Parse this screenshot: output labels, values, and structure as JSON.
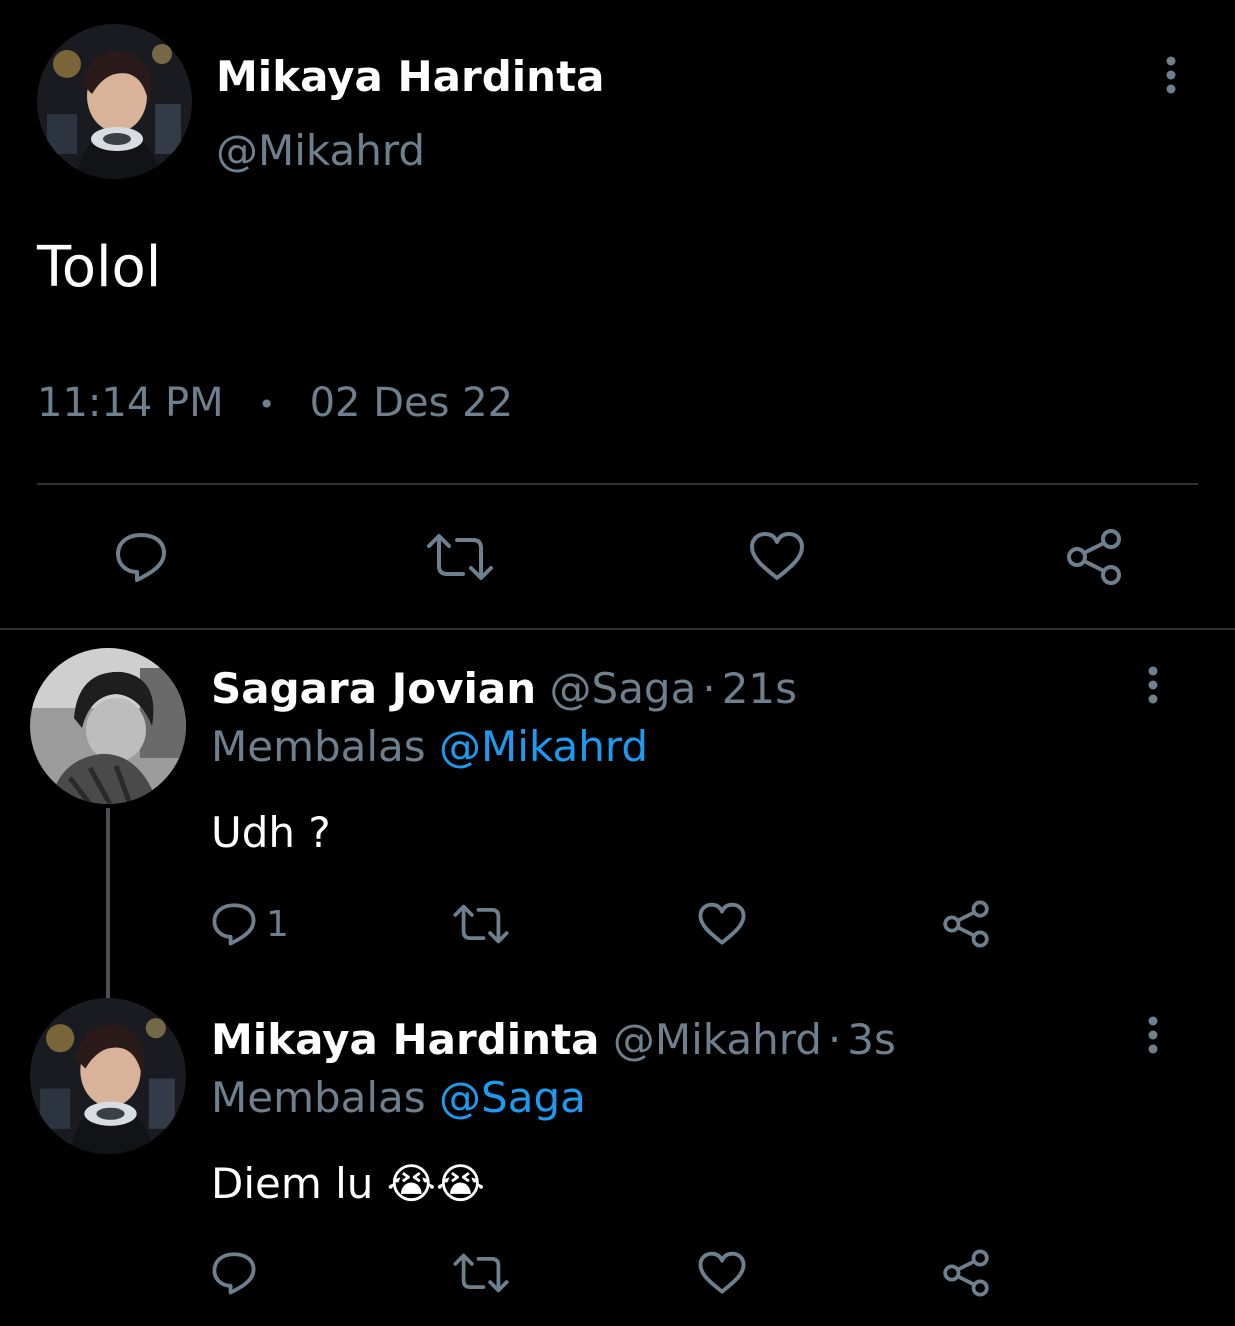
{
  "main_tweet": {
    "display_name": "Mikaya Hardinta",
    "handle": "@Mikahrd",
    "text": "Tolol",
    "time": "11:14 PM",
    "separator": "•",
    "date": "02 Des 22"
  },
  "reply1": {
    "display_name": "Sagara Jovian",
    "handle": "@Saga",
    "dot": "·",
    "age": "21s",
    "replying_prefix": "Membalas",
    "replying_to": "@Mikahrd",
    "text": "Udh ?",
    "reply_count": "1"
  },
  "reply2": {
    "display_name": "Mikaya Hardinta",
    "handle": "@Mikahrd",
    "dot": "·",
    "age": "3s",
    "replying_prefix": "Membalas",
    "replying_to": "@Saga",
    "text": "Diem lu 😭😭"
  },
  "icons": {
    "reply": "speech-bubble-icon",
    "retweet": "retweet-icon",
    "like": "heart-icon",
    "share": "share-icon",
    "more": "more-vertical-icon"
  },
  "colors": {
    "background": "#000000",
    "text": "#ffffff",
    "secondary": "#6e7f8d",
    "link": "#1d9bf0",
    "divider": "#2f3336"
  }
}
